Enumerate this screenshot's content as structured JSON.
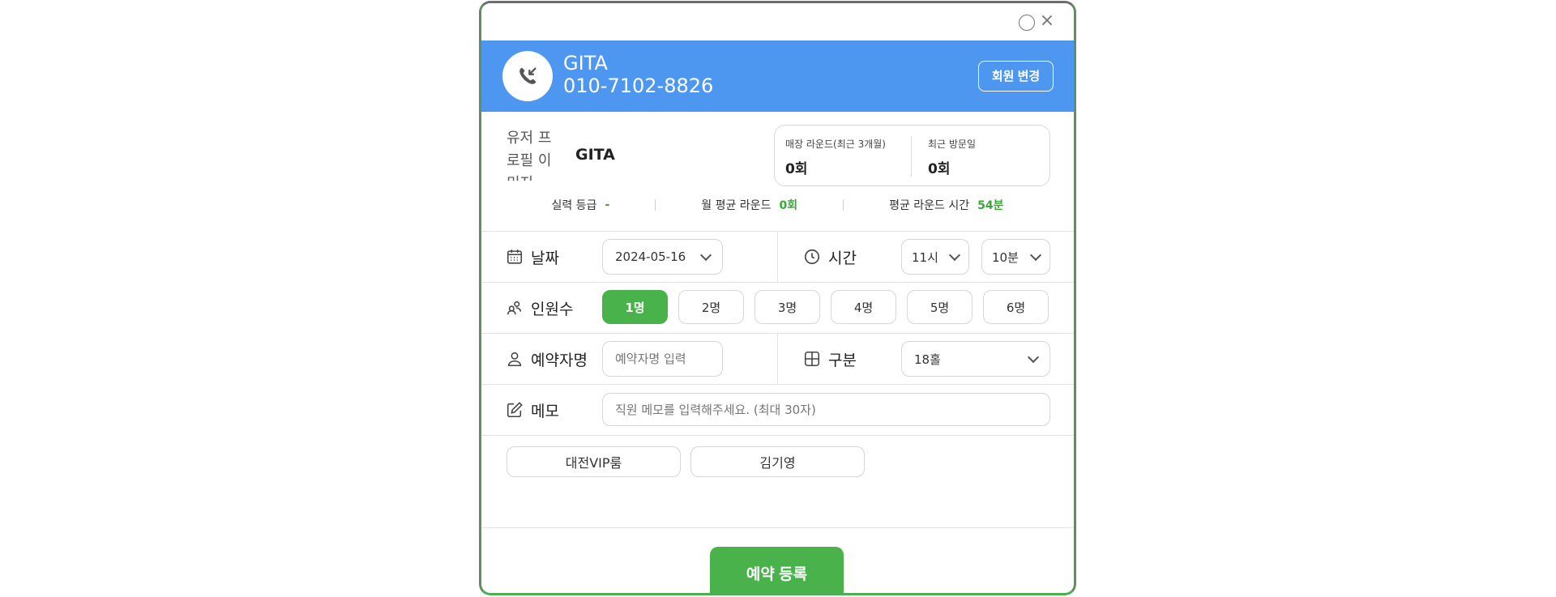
{
  "window": {
    "close_glyph": "×"
  },
  "header": {
    "caller_name": "GITA",
    "caller_phone": "010-7102-8826",
    "member_change_label": "회원 변경"
  },
  "profile": {
    "image_alt": "유저 프로필 이미지",
    "name": "GITA",
    "stats": [
      {
        "label": "매장 라운드(최근 3개월)",
        "value": "0회"
      },
      {
        "label": "최근 방문일",
        "value": "0회"
      }
    ],
    "metrics": [
      {
        "label": "실력 등급",
        "value": "-"
      },
      {
        "label": "월 평균 라운드",
        "value": "0회"
      },
      {
        "label": "평균 라운드 시간",
        "value": "54분"
      }
    ]
  },
  "form": {
    "date_label": "날짜",
    "date_value": "2024-05-16",
    "time_label": "시간",
    "hour_value": "11시",
    "minute_value": "10분",
    "people_label": "인원수",
    "people_options": [
      "1명",
      "2명",
      "3명",
      "4명",
      "5명",
      "6명"
    ],
    "people_selected": "1명",
    "reserver_label": "예약자명",
    "reserver_placeholder": "예약자명 입력",
    "category_label": "구분",
    "category_value": "18홀",
    "memo_label": "메모",
    "memo_placeholder": "직원 메모를 입력해주세요. (최대 30자)"
  },
  "tags": [
    "대전VIP룸",
    "김기영"
  ],
  "submit_label": "예약 등록",
  "colors": {
    "header_blue": "#4e97f1",
    "accent_green": "#49b24a"
  }
}
